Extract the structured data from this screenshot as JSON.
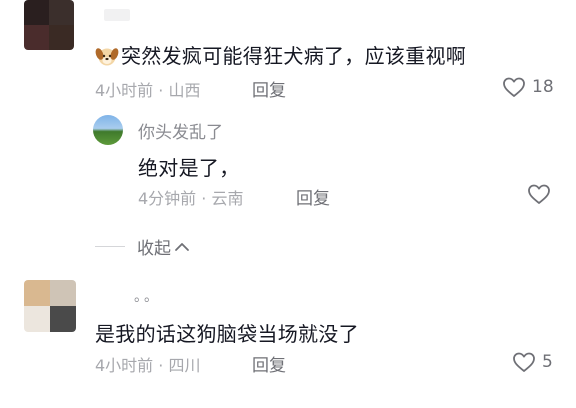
{
  "comments": [
    {
      "username": "",
      "text_emoji": "dog-face-icon",
      "text": "突然发疯可能得狂犬病了，应该重视啊",
      "meta": "4小时前 · 山西",
      "reply_label": "回复",
      "likes": "18",
      "reply": {
        "username": "你头发乱了",
        "text": "绝对是了，",
        "meta": "4分钟前 · 云南",
        "reply_label": "回复"
      },
      "collapse_label": "收起"
    },
    {
      "username": "。。",
      "text": "是我的话这狗脑袋当场就没了",
      "meta": "4小时前 · 四川",
      "reply_label": "回复",
      "likes": "5"
    }
  ]
}
